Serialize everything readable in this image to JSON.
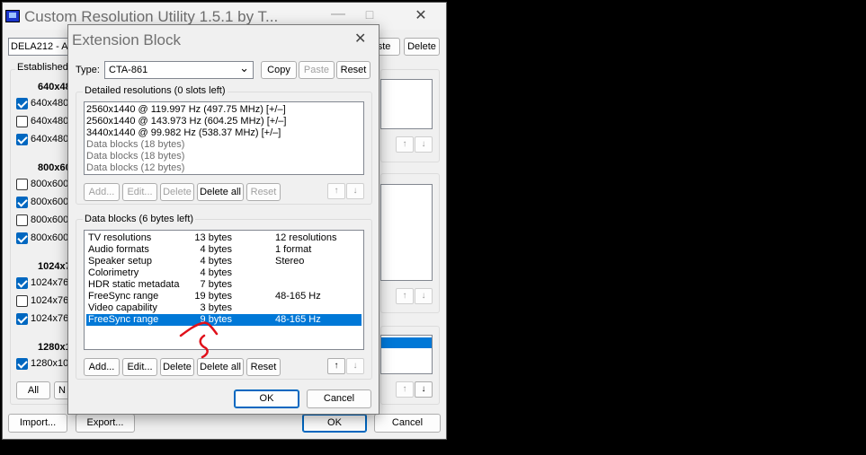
{
  "main": {
    "title": "Custom Resolution Utility 1.5.1 by T...",
    "monitor_value": "DELA212 - AW",
    "established_label": "Established",
    "groups": [
      {
        "heading": "640x48",
        "items": [
          {
            "label": "640x480",
            "checked": true
          },
          {
            "label": "640x480",
            "checked": false
          },
          {
            "label": "640x480",
            "checked": true
          }
        ]
      },
      {
        "heading": "800x60",
        "items": [
          {
            "label": "800x600",
            "checked": false
          },
          {
            "label": "800x600",
            "checked": true
          },
          {
            "label": "800x600",
            "checked": false
          },
          {
            "label": "800x600",
            "checked": true
          }
        ]
      },
      {
        "heading": "1024x7",
        "items": [
          {
            "label": "1024x76",
            "checked": true
          },
          {
            "label": "1024x76",
            "checked": false
          },
          {
            "label": "1024x76",
            "checked": true
          }
        ]
      },
      {
        "heading": "1280x1",
        "items": [
          {
            "label": "1280x10",
            "checked": true
          }
        ]
      }
    ],
    "all_label": "All",
    "none_label": "N",
    "paste_label": "aste",
    "delete_label": "Delete",
    "import_label": "Import...",
    "export_label": "Export...",
    "ok_label": "OK",
    "cancel_label": "Cancel"
  },
  "dialog": {
    "title": "Extension Block",
    "type_label": "Type:",
    "type_value": "CTA-861",
    "copy_label": "Copy",
    "paste_label": "Paste",
    "reset_label": "Reset",
    "detailed": {
      "title": "Detailed resolutions (0 slots left)",
      "rows": [
        {
          "text": "2560x1440 @ 119.997 Hz (497.75 MHz) [+/–]",
          "muted": false
        },
        {
          "text": "2560x1440 @ 143.973 Hz (604.25 MHz) [+/–]",
          "muted": false
        },
        {
          "text": "3440x1440 @ 99.982 Hz (538.37 MHz) [+/–]",
          "muted": false
        },
        {
          "text": "Data blocks (18 bytes)",
          "muted": true
        },
        {
          "text": "Data blocks (18 bytes)",
          "muted": true
        },
        {
          "text": "Data blocks (12 bytes)",
          "muted": true
        }
      ],
      "buttons": {
        "add": "Add...",
        "edit": "Edit...",
        "delete": "Delete",
        "delete_all": "Delete all",
        "reset": "Reset"
      }
    },
    "datablocks": {
      "title": "Data blocks (6 bytes left)",
      "rows": [
        {
          "name": "TV resolutions",
          "size": "13 bytes",
          "info": "12 resolutions",
          "selected": false
        },
        {
          "name": "Audio formats",
          "size": "4 bytes",
          "info": "1 format",
          "selected": false
        },
        {
          "name": "Speaker setup",
          "size": "4 bytes",
          "info": "Stereo",
          "selected": false
        },
        {
          "name": "Colorimetry",
          "size": "4 bytes",
          "info": "",
          "selected": false
        },
        {
          "name": "HDR static metadata",
          "size": "7 bytes",
          "info": "",
          "selected": false
        },
        {
          "name": "FreeSync range",
          "size": "19 bytes",
          "info": "48-165 Hz",
          "selected": false
        },
        {
          "name": "Video capability",
          "size": "3 bytes",
          "info": "",
          "selected": false
        },
        {
          "name": "FreeSync range",
          "size": "9 bytes",
          "info": "48-165 Hz",
          "selected": true
        }
      ],
      "buttons": {
        "add": "Add...",
        "edit": "Edit...",
        "delete": "Delete",
        "delete_all": "Delete all",
        "reset": "Reset"
      }
    },
    "ok_label": "OK",
    "cancel_label": "Cancel"
  },
  "icons": {
    "up": "↑",
    "down": "↓",
    "minimize": "—",
    "maximize": "□",
    "close": "✕",
    "chevron": "⌄"
  },
  "colors": {
    "selection": "#0078d7",
    "annotation": "#e0101a"
  }
}
